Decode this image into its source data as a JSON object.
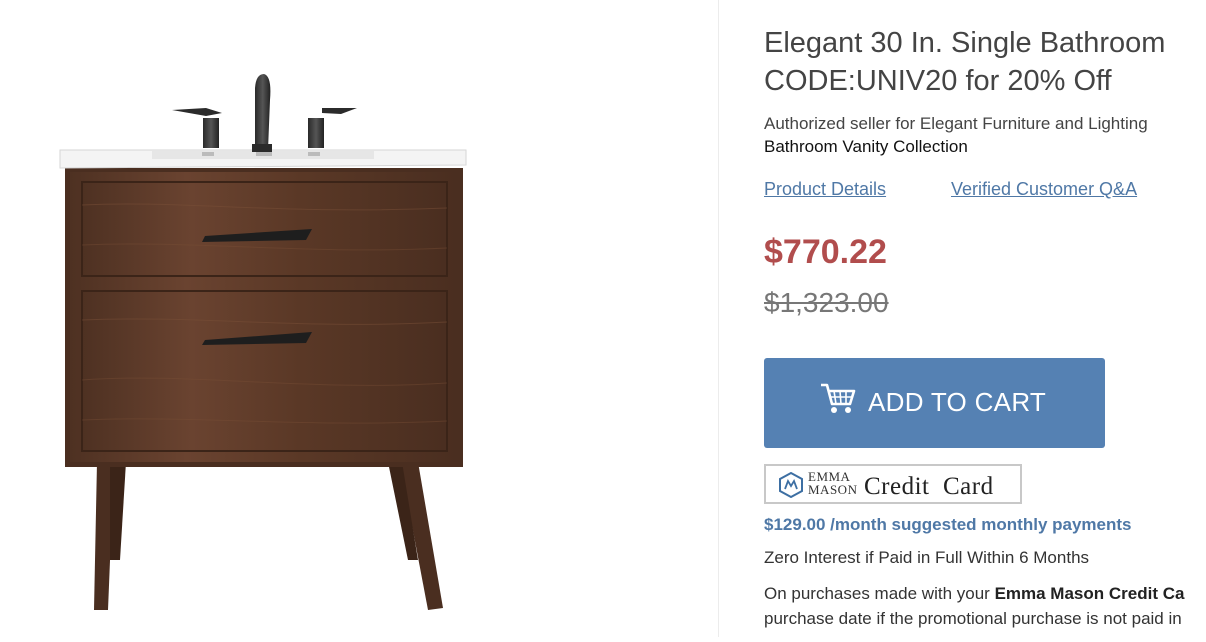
{
  "product": {
    "title_line1": "Elegant 30 In. Single Bathroom",
    "title_line2": "CODE:UNIV20 for 20% Off",
    "seller": "Authorized seller for Elegant Furniture and Lighting",
    "collection": "Bathroom Vanity Collection",
    "image_icon": "bathroom-vanity-image"
  },
  "links": {
    "details": "Product Details",
    "qa": "Verified Customer Q&A"
  },
  "pricing": {
    "price": "$770.22",
    "old_price": "$1,323.00"
  },
  "cart": {
    "label": "ADD TO CART",
    "icon": "shopping-cart-icon"
  },
  "credit": {
    "brand_line1": "EMMA",
    "brand_line2": "MASON",
    "card_text": "Credit  Card",
    "monthly": "$129.00 /month suggested monthly payments",
    "zero_interest": "Zero Interest if Paid in Full Within 6 Months",
    "promo_line1_prefix": "On purchases made with your ",
    "promo_line1_bold": "Emma Mason Credit Ca",
    "promo_line2": "purchase date if the promotional purchase is not paid in"
  },
  "colors": {
    "price_red": "#b14d4d",
    "link_blue": "#4f78a6",
    "cart_blue": "#5581b3",
    "wood": "#5b3a29"
  }
}
